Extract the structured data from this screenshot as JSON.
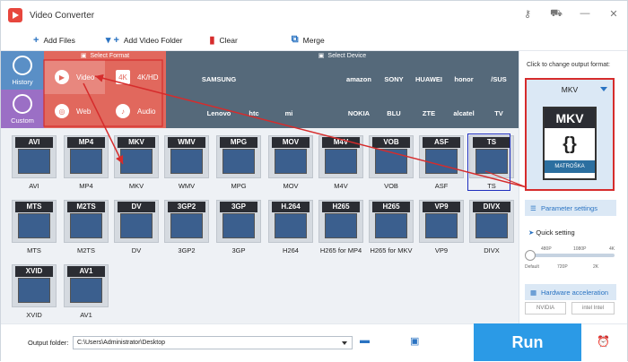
{
  "titlebar": {
    "title": "Video Converter"
  },
  "toolbar": {
    "add_files": "Add Files",
    "add_video_folder": "Add Video Folder",
    "clear": "Clear",
    "merge": "Merge"
  },
  "nav": {
    "history": "History",
    "custom": "Custom"
  },
  "format": {
    "header": "Select Format",
    "categories": [
      {
        "label": "Video"
      },
      {
        "label": "4K/HD"
      },
      {
        "label": "Web"
      },
      {
        "label": "Audio"
      }
    ]
  },
  "device": {
    "header": "Select Device",
    "brands": [
      [
        "",
        "SAMSUNG",
        "",
        "",
        "",
        "amazon",
        "SONY",
        "HUAWEI",
        "honor",
        "/SUS"
      ],
      [
        "",
        "Lenovo",
        "htc",
        "mi",
        "",
        "NOKIA",
        "BLU",
        "ZTE",
        "alcatel",
        "TV"
      ]
    ]
  },
  "formats": [
    {
      "tag": "AVI",
      "label": "AVI"
    },
    {
      "tag": "MP4",
      "label": "MP4"
    },
    {
      "tag": "MKV",
      "label": "MKV"
    },
    {
      "tag": "WMV",
      "label": "WMV"
    },
    {
      "tag": "MPG",
      "label": "MPG"
    },
    {
      "tag": "MOV",
      "label": "MOV"
    },
    {
      "tag": "M4V",
      "label": "M4V"
    },
    {
      "tag": "VOB",
      "label": "VOB"
    },
    {
      "tag": "ASF",
      "label": "ASF"
    },
    {
      "tag": "TS",
      "label": "TS"
    },
    {
      "tag": "MTS",
      "label": "MTS"
    },
    {
      "tag": "M2TS",
      "label": "M2TS"
    },
    {
      "tag": "DV",
      "label": "DV"
    },
    {
      "tag": "3GP2",
      "label": "3GP2"
    },
    {
      "tag": "3GP",
      "label": "3GP"
    },
    {
      "tag": "H.264",
      "label": "H264"
    },
    {
      "tag": "H265",
      "label": "H265 for MP4"
    },
    {
      "tag": "H265",
      "label": "H265 for MKV"
    },
    {
      "tag": "VP9",
      "label": "VP9"
    },
    {
      "tag": "DIVX",
      "label": "DIVX"
    },
    {
      "tag": "XVID",
      "label": "XVID"
    },
    {
      "tag": "AV1",
      "label": "AV1"
    }
  ],
  "right": {
    "hint": "Click to change output format:",
    "output_format": "MKV",
    "param": "Parameter settings",
    "quick": "Quick setting",
    "ticks_top": [
      "480P",
      "1080P",
      "4K"
    ],
    "ticks_bottom": [
      "Default",
      "720P",
      "2K"
    ],
    "hw": "Hardware acceleration",
    "brands": [
      "NVIDIA",
      "intel Intel"
    ],
    "icon_top": "MKV",
    "icon_bot": "MATROŠKA"
  },
  "bottom": {
    "label": "Output folder:",
    "path": "C:\\Users\\Administrator\\Desktop",
    "run": "Run"
  },
  "colors": {
    "format_red": "#e1685d",
    "device_slate": "#55697a",
    "accent_blue": "#2b9ae6",
    "highlight_red": "#d62c2c"
  }
}
